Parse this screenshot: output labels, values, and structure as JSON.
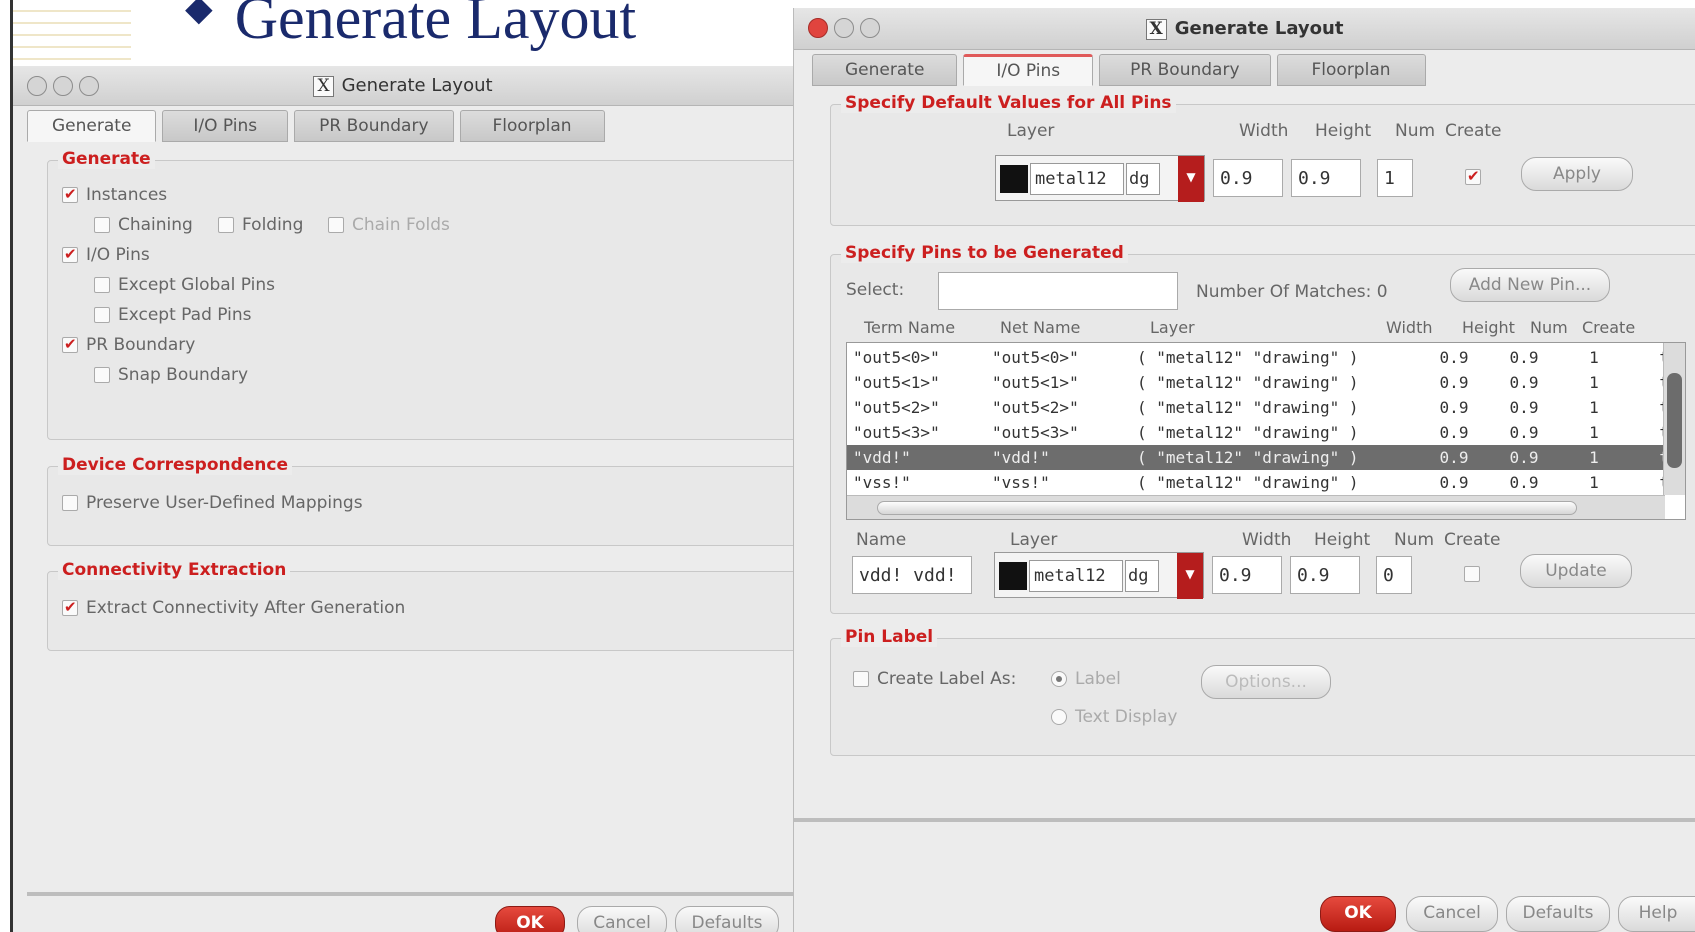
{
  "slide": {
    "bullet": "◆",
    "title": "Generate Layout"
  },
  "win1": {
    "title": "Generate Layout",
    "tabs": [
      "Generate",
      "I/O Pins",
      "PR Boundary",
      "Floorplan"
    ],
    "group_generate": {
      "title": "Generate",
      "instances": "Instances",
      "chaining": "Chaining",
      "folding": "Folding",
      "chain_folds": "Chain Folds",
      "io_pins": "I/O Pins",
      "except_global": "Except Global Pins",
      "except_pad": "Except Pad Pins",
      "pr_boundary": "PR Boundary",
      "snap_boundary": "Snap Boundary"
    },
    "group_device": {
      "title": "Device Correspondence",
      "preserve": "Preserve User-Defined Mappings"
    },
    "group_conn": {
      "title": "Connectivity Extraction",
      "extract": "Extract Connectivity After Generation"
    },
    "buttons": {
      "ok": "OK",
      "cancel": "Cancel",
      "defaults": "Defaults"
    }
  },
  "win2": {
    "title": "Generate Layout",
    "tabs": [
      "Generate",
      "I/O Pins",
      "PR Boundary",
      "Floorplan"
    ],
    "defaults_group": {
      "title": "Specify Default Values for All Pins",
      "layer_label": "Layer",
      "width_label": "Width",
      "height_label": "Height",
      "num_label": "Num",
      "create_label": "Create",
      "layer_name": "metal12",
      "layer_purpose": "dg",
      "width": "0.9",
      "height": "0.9",
      "num": "1",
      "apply": "Apply"
    },
    "pins_group": {
      "title": "Specify Pins to be Generated",
      "select_label": "Select:",
      "select_value": "",
      "matches_label": "Number Of Matches: 0",
      "add_pin": "Add New Pin...",
      "headers": [
        "Term Name",
        "Net Name",
        "Layer",
        "Width",
        "Height",
        "Num",
        "Create"
      ],
      "rows": [
        {
          "term": "\"out5<0>\"",
          "net": "\"out5<0>\"",
          "layer": "( \"metal12\" \"drawing\" )",
          "width": "0.9",
          "height": "0.9",
          "num": "1",
          "create": "t",
          "selected": false
        },
        {
          "term": "\"out5<1>\"",
          "net": "\"out5<1>\"",
          "layer": "( \"metal12\" \"drawing\" )",
          "width": "0.9",
          "height": "0.9",
          "num": "1",
          "create": "t",
          "selected": false
        },
        {
          "term": "\"out5<2>\"",
          "net": "\"out5<2>\"",
          "layer": "( \"metal12\" \"drawing\" )",
          "width": "0.9",
          "height": "0.9",
          "num": "1",
          "create": "t",
          "selected": false
        },
        {
          "term": "\"out5<3>\"",
          "net": "\"out5<3>\"",
          "layer": "( \"metal12\" \"drawing\" )",
          "width": "0.9",
          "height": "0.9",
          "num": "1",
          "create": "t",
          "selected": false
        },
        {
          "term": "\"vdd!\"",
          "net": "\"vdd!\"",
          "layer": "( \"metal12\" \"drawing\" )",
          "width": "0.9",
          "height": "0.9",
          "num": "1",
          "create": "t",
          "selected": true
        },
        {
          "term": "\"vss!\"",
          "net": "\"vss!\"",
          "layer": "( \"metal12\" \"drawing\" )",
          "width": "0.9",
          "height": "0.9",
          "num": "1",
          "create": "t",
          "selected": false
        }
      ],
      "edit": {
        "name_label": "Name",
        "layer_label": "Layer",
        "width_label": "Width",
        "height_label": "Height",
        "num_label": "Num",
        "create_label": "Create",
        "name_value": "vdd! vdd!",
        "layer_name": "metal12",
        "layer_purpose": "dg",
        "width": "0.9",
        "height": "0.9",
        "num": "0",
        "update": "Update"
      }
    },
    "label_group": {
      "title": "Pin Label",
      "create_as": "Create Label As:",
      "label_opt": "Label",
      "text_display": "Text Display",
      "options": "Options..."
    },
    "buttons": {
      "ok": "OK",
      "cancel": "Cancel",
      "defaults": "Defaults",
      "help": "Help"
    }
  },
  "colors": {
    "accent_red": "#cc1f1f",
    "ok_red": "#c8261b",
    "window_bg": "#ececec",
    "title_blue": "#1a2a6c"
  }
}
